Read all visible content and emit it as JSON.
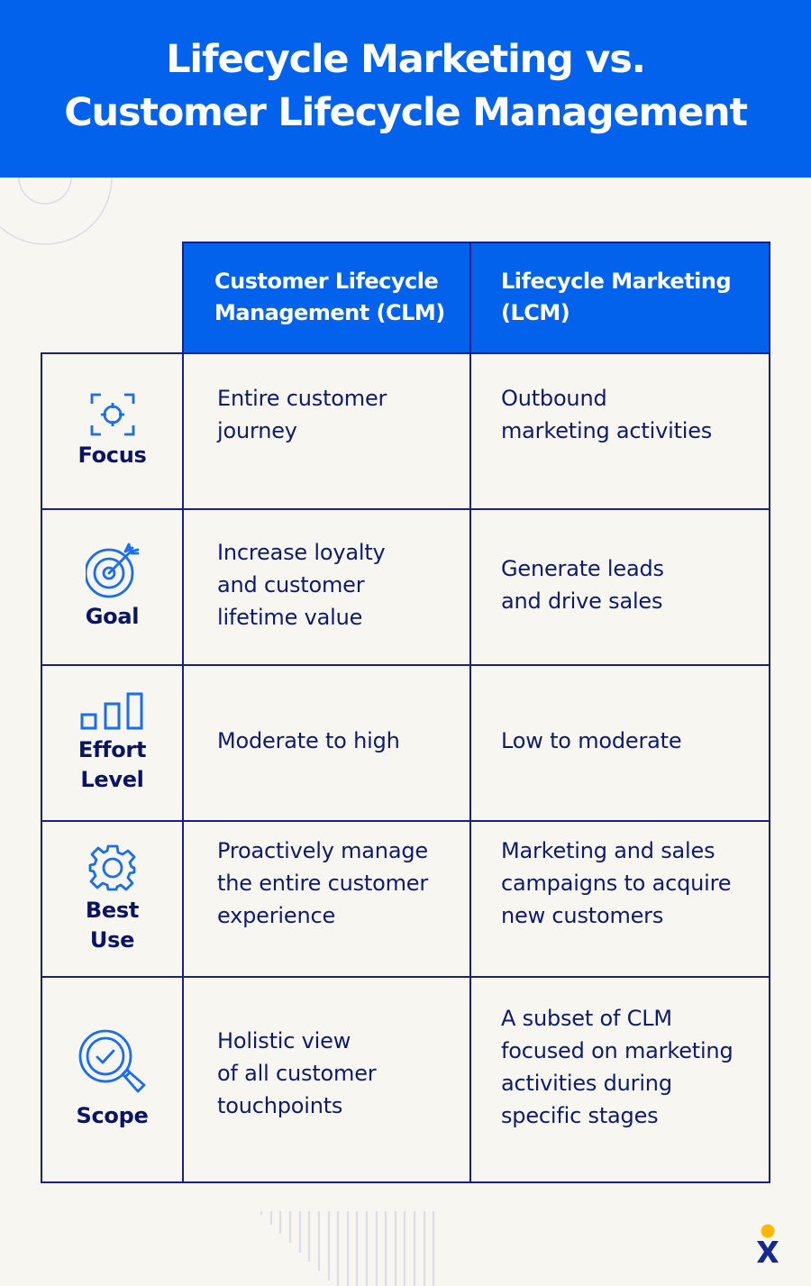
{
  "title": {
    "line1": "Lifecycle Marketing vs.",
    "line2": "Customer Lifecycle Management"
  },
  "table": {
    "columns": [
      {
        "line1": "Customer Lifecycle",
        "line2": "Management (CLM)"
      },
      {
        "line1": "Lifecycle Marketing",
        "line2": "(LCM)"
      }
    ],
    "rows": [
      {
        "icon": "focus-target-icon",
        "label": [
          "Focus"
        ],
        "clm": [
          "Entire customer",
          "journey"
        ],
        "lcm": [
          "Outbound",
          "marketing activities"
        ]
      },
      {
        "icon": "goal-bullseye-icon",
        "label": [
          "Goal"
        ],
        "clm": [
          "Increase loyalty",
          "and customer",
          "lifetime value"
        ],
        "lcm": [
          "Generate leads",
          "and drive sales"
        ]
      },
      {
        "icon": "bar-chart-icon",
        "label": [
          "Effort",
          "Level"
        ],
        "clm": [
          "Moderate to high"
        ],
        "lcm": [
          "Low to moderate"
        ]
      },
      {
        "icon": "gear-icon",
        "label": [
          "Best",
          "Use"
        ],
        "clm": [
          "Proactively manage",
          "the entire customer",
          "experience"
        ],
        "lcm": [
          "Marketing and sales",
          "campaigns to acquire",
          "new customers"
        ]
      },
      {
        "icon": "magnifier-check-icon",
        "label": [
          "Scope"
        ],
        "clm": [
          "Holistic view",
          "of all customer",
          "touchpoints"
        ],
        "lcm": [
          "A subset of CLM",
          "focused on marketing",
          "activities during",
          "specific stages"
        ]
      }
    ]
  },
  "colors": {
    "brand_blue": "#0362eb",
    "navy": "#1a1f85",
    "text_navy": "#0f1a6e",
    "background": "#f7f6f0",
    "logo_yellow": "#ffb800"
  },
  "logo": "brand-logo-x-icon"
}
